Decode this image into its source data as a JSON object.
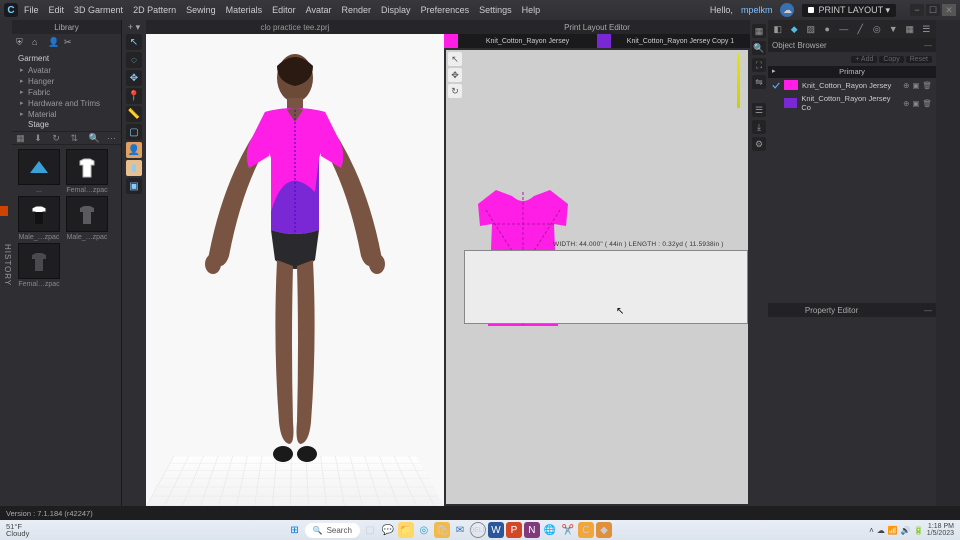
{
  "menu": {
    "file": "File",
    "edit": "Edit",
    "garment": "3D Garment",
    "pattern": "2D Pattern",
    "sewing": "Sewing",
    "materials": "Materials",
    "editor": "Editor",
    "avatar": "Avatar",
    "render": "Render",
    "display": "Display",
    "preferences": "Preferences",
    "settings": "Settings",
    "help": "Help"
  },
  "title": {
    "hello": "Hello,",
    "user": "mpelkm",
    "mode": "PRINT LAYOUT ▾"
  },
  "left": {
    "tab": "Library",
    "scene_header": "Garment",
    "items": [
      "Avatar",
      "Hanger",
      "Fabric",
      "Hardware and Trims",
      "Material"
    ],
    "stage": "Stage",
    "thumbs": [
      {
        "lbl": "...",
        "svg": "shears"
      },
      {
        "lbl": "Femal…zpac",
        "svg": "tee-white"
      },
      {
        "lbl": "Male_…zpac",
        "svg": "tee-bw"
      },
      {
        "lbl": "Male_…zpac",
        "svg": "tee-grey"
      },
      {
        "lbl": "Femal…zpac",
        "svg": "tee-grey"
      }
    ]
  },
  "center": {
    "tab": "clo practice tee.zprj"
  },
  "print": {
    "tab": "Print Layout Editor",
    "sw1": "#ff1ee6",
    "lbl1": "Knit_Cotton_Rayon Jersey",
    "sw2": "#7a27d6",
    "lbl2": "Knit_Cotton_Rayon Jersey Copy 1",
    "fabric": "WIDTH: 44.000\" ( 44in )   LENGTH : 0.32yd ( 11.5938in )"
  },
  "right": {
    "browser": "Object Browser",
    "add": "+ Add",
    "copy": "Copy",
    "reset": "Reset",
    "primary": "Primary",
    "rows": [
      {
        "c": "#ff1ee6",
        "t": "Knit_Cotton_Rayon Jersey",
        "checked": true
      },
      {
        "c": "#7a27d6",
        "t": "Knit_Cotton_Rayon Jersey Co",
        "checked": false
      }
    ],
    "prop": "Property Editor"
  },
  "status": "Version : 7.1.184 (r42247)",
  "taskbar": {
    "temp": "51°F",
    "cond": "Cloudy",
    "search": "Search",
    "time": "1:18 PM",
    "date": "1/5/2023"
  },
  "hist": "HISTORY"
}
